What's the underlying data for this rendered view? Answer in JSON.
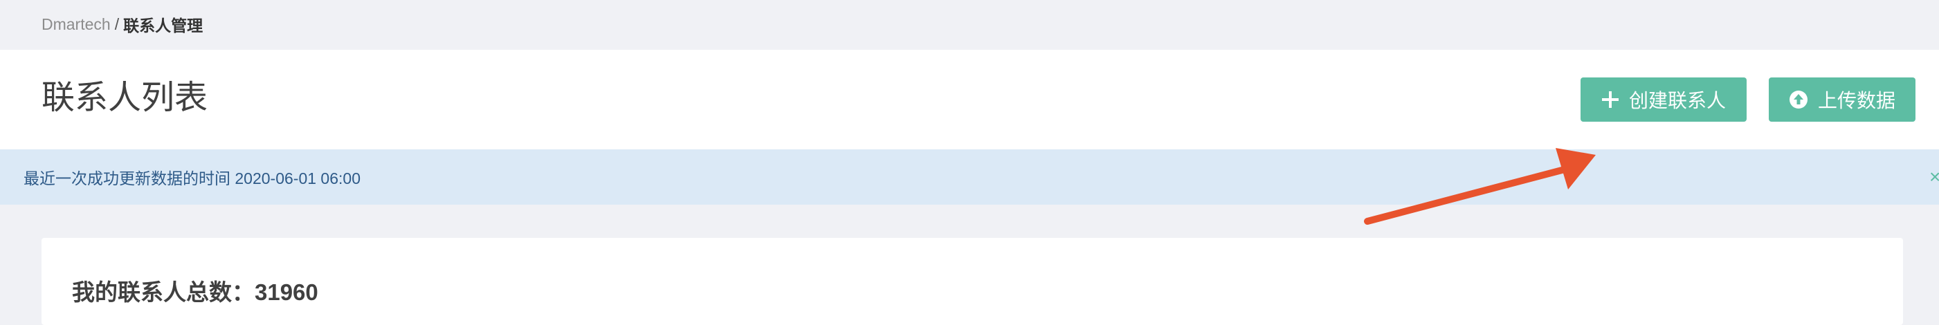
{
  "breadcrumb": {
    "root": "Dmartech",
    "separator": "/",
    "current": "联系人管理"
  },
  "header": {
    "title": "联系人列表",
    "create_button": "创建联系人",
    "upload_button": "上传数据"
  },
  "notice": {
    "text": "最近一次成功更新数据的时间 2020-06-01 06:00",
    "close_symbol": "×"
  },
  "stats": {
    "label": "我的联系人总数：",
    "value": "31960"
  },
  "colors": {
    "accent": "#5dbda3",
    "notice_bg": "#dbe9f6",
    "annotation_arrow": "#e8532d"
  },
  "icons": {
    "create": "plus-icon",
    "upload": "upload-circle-icon",
    "close": "close-icon"
  }
}
